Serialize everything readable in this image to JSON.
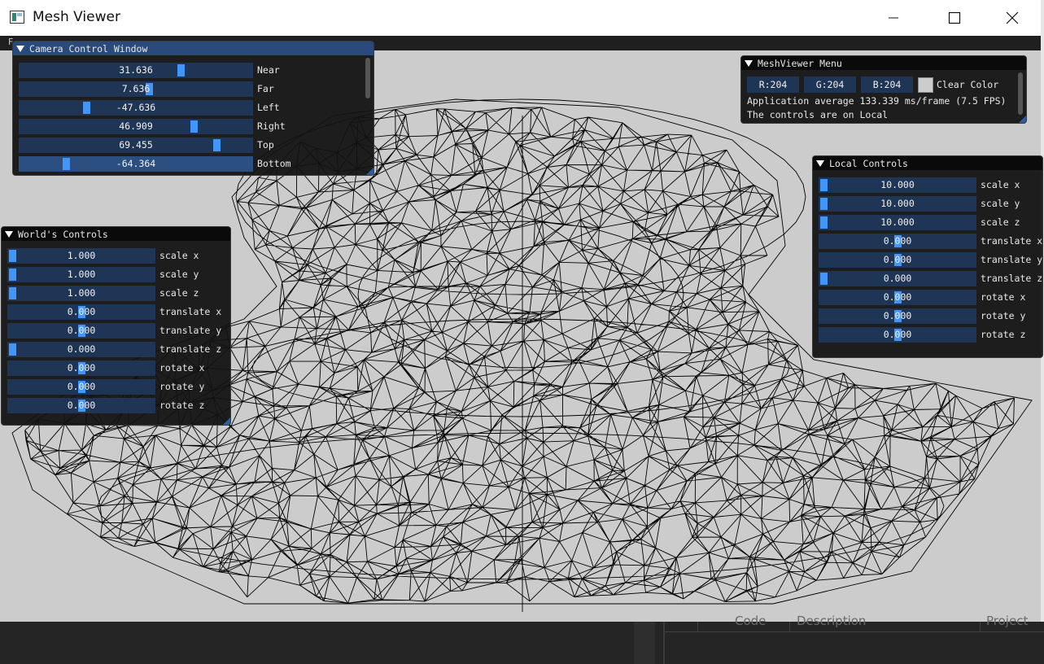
{
  "app": {
    "title": "Mesh Viewer"
  },
  "menubar": {
    "first_letter": "F"
  },
  "camera_panel": {
    "title": "Camera Control Window",
    "rows": [
      {
        "value": "31.636",
        "label": "Near",
        "level": 0.7
      },
      {
        "value": "7.636",
        "label": "Far",
        "level": 0.56
      },
      {
        "value": "-47.636",
        "label": "Left",
        "level": 0.28
      },
      {
        "value": "46.909",
        "label": "Right",
        "level": 0.76
      },
      {
        "value": "69.455",
        "label": "Top",
        "level": 0.86
      },
      {
        "value": "-64.364",
        "label": "Bottom",
        "level": 0.19
      }
    ]
  },
  "menu_panel": {
    "title": "MeshViewer Menu",
    "r": "R:204",
    "g": "G:204",
    "b": "B:204",
    "clear_color_label": "Clear Color",
    "clear_color": "#cccccc",
    "fps_text": "Application average 133.339 ms/frame (7.5 FPS)",
    "controls_text": "The controls are on Local"
  },
  "world_panel": {
    "title": "World's Controls",
    "rows": [
      {
        "value": "1.000",
        "label": "scale x",
        "level": 0.0
      },
      {
        "value": "1.000",
        "label": "scale y",
        "level": 0.0
      },
      {
        "value": "1.000",
        "label": "scale z",
        "level": 0.0
      },
      {
        "value": "0.000",
        "label": "translate x",
        "level": 0.5
      },
      {
        "value": "0.000",
        "label": "translate y",
        "level": 0.5
      },
      {
        "value": "0.000",
        "label": "translate z",
        "level": 0.0
      },
      {
        "value": "0.000",
        "label": "rotate x",
        "level": 0.5
      },
      {
        "value": "0.000",
        "label": "rotate y",
        "level": 0.5
      },
      {
        "value": "0.000",
        "label": "rotate z",
        "level": 0.5
      }
    ]
  },
  "local_panel": {
    "title": "Local Controls",
    "rows": [
      {
        "value": "10.000",
        "label": "scale x",
        "level": 0.0
      },
      {
        "value": "10.000",
        "label": "scale y",
        "level": 0.0
      },
      {
        "value": "10.000",
        "label": "scale z",
        "level": 0.0
      },
      {
        "value": "0.000",
        "label": "translate x",
        "level": 0.5
      },
      {
        "value": "0.000",
        "label": "translate y",
        "level": 0.5
      },
      {
        "value": "0.000",
        "label": "translate z",
        "level": 0.0
      },
      {
        "value": "0.000",
        "label": "rotate x",
        "level": 0.5
      },
      {
        "value": "0.000",
        "label": "rotate y",
        "level": 0.5
      },
      {
        "value": "0.000",
        "label": "rotate z",
        "level": 0.5
      }
    ]
  },
  "background_ide": {
    "col_code": "Code",
    "col_description": "Description",
    "col_project": "Project"
  },
  "colors": {
    "accent": "#4296fa",
    "slider_bg": "#1f3556",
    "viewport_bg": "#cccccc",
    "mesh": "#000000"
  }
}
